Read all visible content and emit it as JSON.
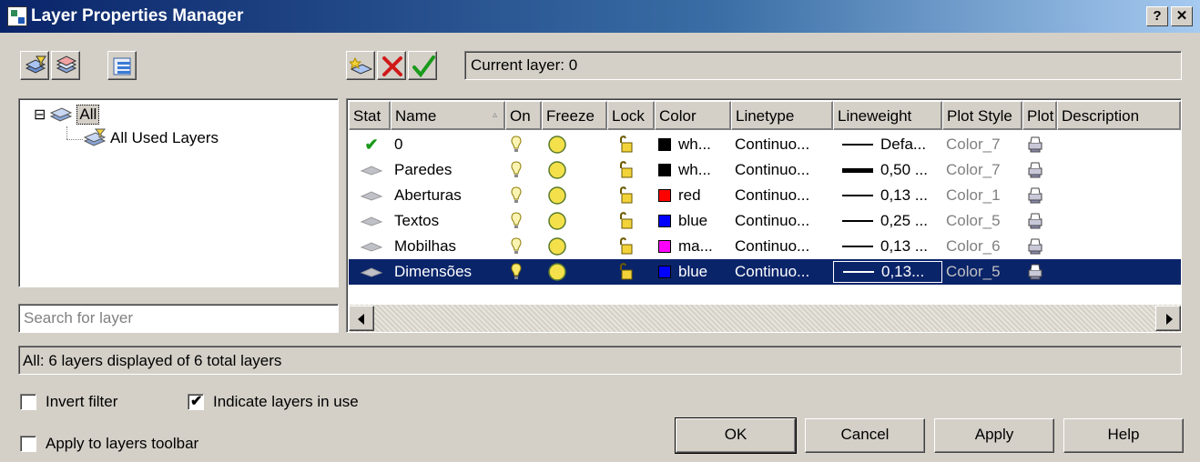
{
  "window": {
    "title": "Layer Properties Manager",
    "help_btn": "?",
    "close_btn": "✕"
  },
  "toolbar": {
    "left_icons": [
      "new-property-filter-icon",
      "new-group-filter-icon",
      "layer-states-manager-icon"
    ],
    "right_icons": [
      "new-layer-icon",
      "delete-layer-icon",
      "set-current-icon"
    ],
    "current_layer": "Current layer: 0"
  },
  "tree": {
    "collapse": "⊟",
    "root": "All",
    "child": "All Used Layers"
  },
  "search": {
    "placeholder": "Search for layer"
  },
  "grid": {
    "columns": [
      "Stat",
      "Name",
      "On",
      "Freeze",
      "Lock",
      "Color",
      "Linetype",
      "Lineweight",
      "Plot Style",
      "Plot",
      "Description"
    ],
    "rows": [
      {
        "status": "current",
        "name": "0",
        "color_hex": "#000000",
        "color_name": "wh...",
        "linetype": "Continuo...",
        "lineweight": "Defa...",
        "lineweight_thick": false,
        "plot_style": "Color_7",
        "selected": false
      },
      {
        "status": "unused",
        "name": "Paredes",
        "color_hex": "#000000",
        "color_name": "wh...",
        "linetype": "Continuo...",
        "lineweight": "0,50 ...",
        "lineweight_thick": true,
        "plot_style": "Color_7",
        "selected": false
      },
      {
        "status": "unused",
        "name": "Aberturas",
        "color_hex": "#ff0000",
        "color_name": "red",
        "linetype": "Continuo...",
        "lineweight": "0,13 ...",
        "lineweight_thick": false,
        "plot_style": "Color_1",
        "selected": false
      },
      {
        "status": "unused",
        "name": "Textos",
        "color_hex": "#0000ff",
        "color_name": "blue",
        "linetype": "Continuo...",
        "lineweight": "0,25 ...",
        "lineweight_thick": false,
        "plot_style": "Color_5",
        "selected": false
      },
      {
        "status": "unused",
        "name": "Mobilhas",
        "color_hex": "#ff00ff",
        "color_name": "ma...",
        "linetype": "Continuo...",
        "lineweight": "0,13 ...",
        "lineweight_thick": false,
        "plot_style": "Color_6",
        "selected": false
      },
      {
        "status": "unused",
        "name": "Dimensões",
        "color_hex": "#0000ff",
        "color_name": "blue",
        "linetype": "Continuo...",
        "lineweight": "0,13...",
        "lineweight_thick": false,
        "plot_style": "Color_5",
        "selected": true
      }
    ]
  },
  "status_text": "All: 6 layers displayed of 6 total layers",
  "options": {
    "invert_filter": {
      "label": "Invert filter",
      "checked": false
    },
    "indicate_in_use": {
      "label": "Indicate layers in use",
      "checked": true
    },
    "apply_toolbar": {
      "label": "Apply to layers toolbar",
      "checked": false
    }
  },
  "buttons": {
    "ok": "OK",
    "cancel": "Cancel",
    "apply": "Apply",
    "help": "Help"
  },
  "colors": {
    "title_start": "#0a246a",
    "title_end": "#a6caf0",
    "selection": "#0a246a",
    "dialog_bg": "#d4d0c8"
  }
}
